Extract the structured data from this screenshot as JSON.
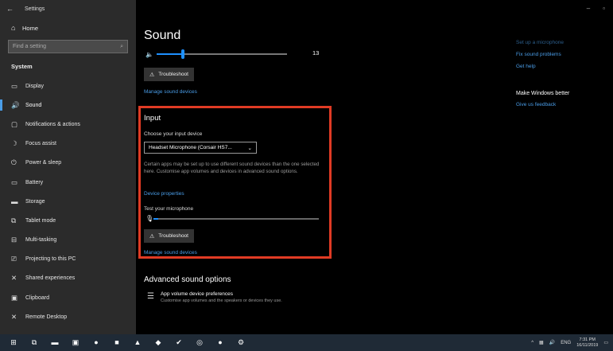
{
  "sidebar": {
    "window_title": "Settings",
    "home_label": "Home",
    "search_placeholder": "Find a setting",
    "section_label": "System",
    "items": [
      {
        "label": "Display",
        "icon": "monitor-icon",
        "glyph": "▭"
      },
      {
        "label": "Sound",
        "icon": "speaker-icon",
        "glyph": "🔊",
        "active": true
      },
      {
        "label": "Notifications & actions",
        "icon": "notification-icon",
        "glyph": "▢"
      },
      {
        "label": "Focus assist",
        "icon": "moon-icon",
        "glyph": "☽"
      },
      {
        "label": "Power & sleep",
        "icon": "power-icon",
        "glyph": "⏻"
      },
      {
        "label": "Battery",
        "icon": "battery-icon",
        "glyph": "▭"
      },
      {
        "label": "Storage",
        "icon": "storage-icon",
        "glyph": "▬"
      },
      {
        "label": "Tablet mode",
        "icon": "tablet-icon",
        "glyph": "⧉"
      },
      {
        "label": "Multi-tasking",
        "icon": "multitasking-icon",
        "glyph": "⊟"
      },
      {
        "label": "Projecting to this PC",
        "icon": "projector-icon",
        "glyph": "⎚"
      },
      {
        "label": "Shared experiences",
        "icon": "shared-icon",
        "glyph": "✕"
      },
      {
        "label": "Clipboard",
        "icon": "clipboard-icon",
        "glyph": "▣"
      },
      {
        "label": "Remote Desktop",
        "icon": "remote-icon",
        "glyph": "✕"
      }
    ]
  },
  "main": {
    "title": "Sound",
    "volume_value": "13",
    "volume_fraction": 0.2,
    "output_troubleshoot": "Troubleshoot",
    "output_manage_link": "Manage sound devices",
    "input": {
      "heading": "Input",
      "choose_label": "Choose your input device",
      "selected_device": "Headset Microphone (Corsair HS7...",
      "description": "Certain apps may be set up to use different sound devices than the one selected here. Customise app volumes and devices in advanced sound options.",
      "device_properties_link": "Device properties",
      "test_label": "Test your microphone",
      "mic_level_fraction": 0.03,
      "troubleshoot": "Troubleshoot",
      "manage_link": "Manage sound devices"
    },
    "advanced": {
      "heading": "Advanced sound options",
      "pref_title": "App volume  device preferences",
      "pref_sub": "Customise app volumes and the speakers or devices they use."
    }
  },
  "right": {
    "top_link": "Set up a microphone",
    "fix_link": "Fix sound problems",
    "help_link": "Get help",
    "better_heading": "Make Windows better",
    "feedback_link": "Give us feedback"
  },
  "window_controls": {
    "minimize": "–",
    "maximize": "▫"
  },
  "taskbar": {
    "icons": [
      {
        "name": "start-icon",
        "glyph": "⊞"
      },
      {
        "name": "task-view-icon",
        "glyph": "⧉"
      },
      {
        "name": "explorer-icon",
        "glyph": "▬"
      },
      {
        "name": "app-icon",
        "glyph": "▣"
      },
      {
        "name": "chrome-icon",
        "glyph": "●"
      },
      {
        "name": "app2-icon",
        "glyph": "■"
      },
      {
        "name": "app3-icon",
        "glyph": "▲"
      },
      {
        "name": "app4-icon",
        "glyph": "◆"
      },
      {
        "name": "check-icon",
        "glyph": "✔"
      },
      {
        "name": "app5-icon",
        "glyph": "◎"
      },
      {
        "name": "app6-icon",
        "glyph": "●"
      },
      {
        "name": "settings-icon",
        "glyph": "⚙"
      }
    ],
    "lang": "ENG",
    "time": "7:31 PM",
    "date": "16/11/2019"
  },
  "colors": {
    "accent": "#1e90ff",
    "highlight_box": "#e03b24",
    "link": "#4a9de8"
  }
}
